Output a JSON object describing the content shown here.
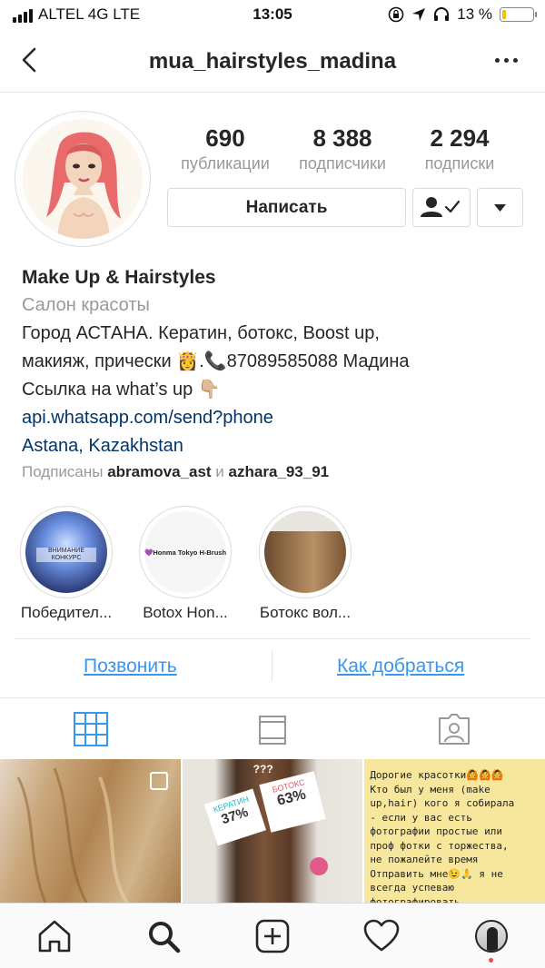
{
  "status_bar": {
    "carrier": "ALTEL 4G  LTE",
    "time": "13:05",
    "battery": "13 %",
    "battery_level": 0.13
  },
  "nav": {
    "title": "mua_hairstyles_madina",
    "back_icon": "chevron-left-icon",
    "more_icon": "more-horizontal-icon"
  },
  "stats": [
    {
      "value": "690",
      "label": "публикации"
    },
    {
      "value": "8 388",
      "label": "подписчики"
    },
    {
      "value": "2 294",
      "label": "подписки"
    }
  ],
  "buttons": {
    "message": "Написать",
    "following_icon": "person-check-icon",
    "dropdown_icon": "triangle-down-icon"
  },
  "bio": {
    "name": "Make Up & Hairstyles",
    "category": "Салон красоты",
    "line1": "Город АСТАНА. Кератин, ботокс, Boost up,",
    "line2": "макияж, прически 👸.📞87089585088 Мадина",
    "line3": "Ссылка на what’s up 👇🏼",
    "link": "api.whatsapp.com/send?phone",
    "location": "Astana, Kazakhstan",
    "followed_prefix": "Подписаны",
    "followed_user1": "abramova_ast",
    "followed_and": "и",
    "followed_user2": "azhara_93_91"
  },
  "highlights": [
    {
      "label": "Победител...",
      "cover_text": "ВНИМАНИЕ КОНКУРС"
    },
    {
      "label": "Botox Hon...",
      "cover_text": "💜Honma Tokyo H-Brush"
    },
    {
      "label": "Ботокс вол...",
      "cover_text": ""
    }
  ],
  "actions": {
    "call": "Позвонить",
    "directions": "Как добраться"
  },
  "tabs": [
    "grid-icon",
    "tv-icon",
    "tagged-icon"
  ],
  "posts": {
    "p2_top": "???",
    "p2_left": "КЕРАТИН",
    "p2_left_val": "37%",
    "p2_right": "БОТОКС",
    "p2_right_val": "63%",
    "p3_lines": [
      "Дорогие красотки🙆🙆🙆",
      "Кто был у меня (make",
      "up,hair) кого я собирала",
      "- если у вас есть",
      "фотографии  простые или",
      "проф фотки с торжества,",
      "не пожалейте время",
      "Отправить мне😉🙏 я не",
      "всегда успеваю",
      "фотографировать."
    ]
  },
  "tabbar": [
    "home-icon",
    "search-icon",
    "add-icon",
    "heart-icon",
    "profile-avatar"
  ],
  "colors": {
    "link": "#003569",
    "action": "#3897f0",
    "muted": "#999999",
    "text": "#262626"
  }
}
